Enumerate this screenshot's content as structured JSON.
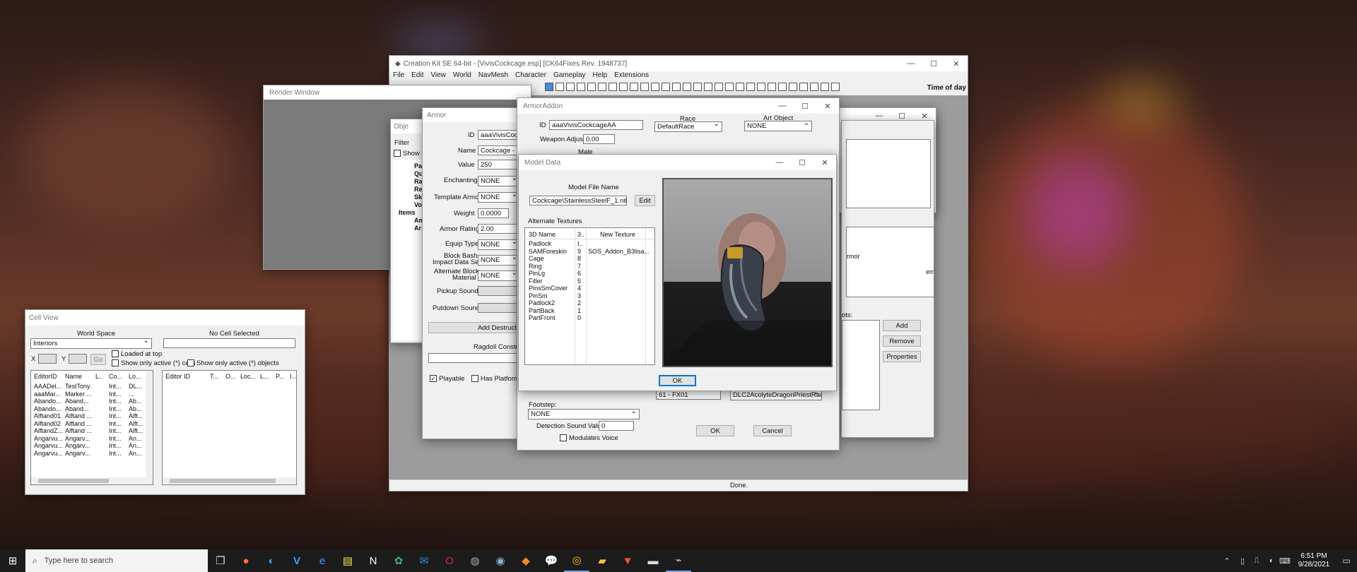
{
  "main_window": {
    "title": "Creation Kit SE 64-bit - [VivisCockcage.esp] [CK64Fixes Rev. 1948737]",
    "menu": [
      "File",
      "Edit",
      "View",
      "World",
      "NavMesh",
      "Character",
      "Gameplay",
      "Help",
      "Extensions"
    ],
    "time_of_day_label": "Time of day",
    "status": "Done."
  },
  "render_window": {
    "title": "Render Window"
  },
  "object_window": {
    "title_fragment": "Obje",
    "filter_label": "Filter",
    "show_label": "Show o",
    "tree_items": [
      "Pa",
      "Qu",
      "Ra",
      "Re",
      "Sk",
      "Vo",
      "Items",
      "Am",
      "Ar"
    ]
  },
  "armor": {
    "title": "Armor",
    "id_label": "ID",
    "id_value": "aaaVivisCockc",
    "name_label": "Name",
    "name_value": "Cockcage - St",
    "value_label": "Value",
    "value_value": "250",
    "enchanting_label": "Enchanting",
    "enchanting_value": "NONE",
    "template_label": "Template Armor",
    "template_value": "NONE",
    "weight_label": "Weight",
    "weight_value": "0.0000",
    "rating_label": "Armor Rating",
    "rating_value": "2.00",
    "equip_label": "Equip Type",
    "equip_value": "NONE",
    "block_bash_label_1": "Block Bash",
    "block_bash_label_2": "Impact Data Set",
    "block_bash_value": "NONE",
    "alt_block_label_1": "Alternate Block",
    "alt_block_label_2": "Material",
    "alt_block_value": "NONE",
    "pickup_label": "Pickup Sound",
    "putdown_label": "Putdown Sound",
    "add_destruction": "Add Destructi",
    "ragdoll_label": "Ragdoll Constrain",
    "playable_label": "Playable",
    "platform_label": "Has Platform/"
  },
  "armor_addon": {
    "title": "ArmorAddon",
    "id_label": "ID",
    "id_value": "aaaVivisCockcageAA",
    "weapon_adjust_label": "Weapon Adjust",
    "weapon_adjust_value": "0.00",
    "male_label": "Male",
    "race_label": "Race",
    "race_value": "DefaultRace",
    "art_object_label": "Art Object",
    "art_object_value": "NONE",
    "footstep_label": "Footstep:",
    "footstep_value": "NONE",
    "detection_label": "Detection Sound Value",
    "detection_value": "0",
    "modulates_label": "Modulates Voice",
    "bipart_value": "61 - FX01",
    "race_list_value": "DLC2AcolyteDragonPriestRace",
    "ok": "OK",
    "cancel": "Cancel"
  },
  "behind_window": {
    "armor_text": "rmor",
    "females_text": "emales",
    "slots_text": "ots:",
    "add": "Add",
    "remove": "Remove",
    "properties": "Properties"
  },
  "model_data": {
    "title": "Model Data",
    "model_file_label": "Model File Name",
    "model_file_value": "Cockcage\\StainlessSteelF_1.nif",
    "edit_button": "Edit",
    "alt_textures_label": "Alternate Textures",
    "col_3d_name": "3D Name",
    "col_idx": "3..",
    "col_new_texture": "New Texture",
    "rows": [
      {
        "name": "Padlock",
        "idx": "I..",
        "tex": ""
      },
      {
        "name": "SAMForeskin",
        "idx": "9",
        "tex": "SOS_Addon_B3lisa..."
      },
      {
        "name": "Cage",
        "idx": "8",
        "tex": ""
      },
      {
        "name": "Ring",
        "idx": "7",
        "tex": ""
      },
      {
        "name": "PinLg",
        "idx": "6",
        "tex": ""
      },
      {
        "name": "Filler",
        "idx": "5",
        "tex": ""
      },
      {
        "name": "PinsSmCover",
        "idx": "4",
        "tex": ""
      },
      {
        "name": "PinSm",
        "idx": "3",
        "tex": ""
      },
      {
        "name": "Padlock2",
        "idx": "2",
        "tex": ""
      },
      {
        "name": "PartBack",
        "idx": "1",
        "tex": ""
      },
      {
        "name": "PartFront",
        "idx": "0",
        "tex": ""
      }
    ],
    "ok": "OK"
  },
  "cell_view": {
    "title": "Cell View",
    "world_space_label": "World Space",
    "no_cell_label": "No Cell Selected",
    "world_value": "Interiors",
    "x_label": "X",
    "y_label": "Y",
    "go": "Go",
    "loaded_at_top": "Loaded at top",
    "only_active_cells": "Show only active (*) cells",
    "only_active_objects": "Show only active (*) objects",
    "left_cols": [
      "EditorID",
      "Name",
      "L..",
      "Co...",
      "Lo..."
    ],
    "right_cols": [
      "Editor ID",
      "T...",
      "O...",
      "Loc...",
      "L...",
      "P...",
      "I..."
    ],
    "left_rows": [
      [
        "AAADel...",
        "TestTony",
        "",
        "Int...",
        "DL..."
      ],
      [
        "aaaMar...",
        "Marker ...",
        "",
        "Int...",
        "..."
      ],
      [
        "Abando...",
        "Aband...",
        "",
        "Int...",
        "Ab..."
      ],
      [
        "Abando...",
        "Aband...",
        "",
        "Int...",
        "Ab..."
      ],
      [
        "Alftand01",
        "Alftand ...",
        "",
        "Int...",
        "Alft..."
      ],
      [
        "Alftand02",
        "Alftand ...",
        "",
        "Int...",
        "Alft..."
      ],
      [
        "AlftandZ...",
        "Alftand ...",
        "",
        "Int...",
        "Alft..."
      ],
      [
        "Angarvu...",
        "Angarv...",
        "",
        "Int...",
        "An..."
      ],
      [
        "Angarvu...",
        "Angarv...",
        "",
        "Int...",
        "An..."
      ],
      [
        "Angarvu...",
        "Angarv...",
        "",
        "Int...",
        "An..."
      ]
    ]
  },
  "taskbar": {
    "search_placeholder": "Type here to search",
    "time": "6:51 PM",
    "date": "9/28/2021"
  },
  "colors": {
    "taskbar": "#1c1c1c",
    "window_bg": "#f0f0f0",
    "render_bg": "#7b7b7b",
    "accent": "#0078d7"
  }
}
